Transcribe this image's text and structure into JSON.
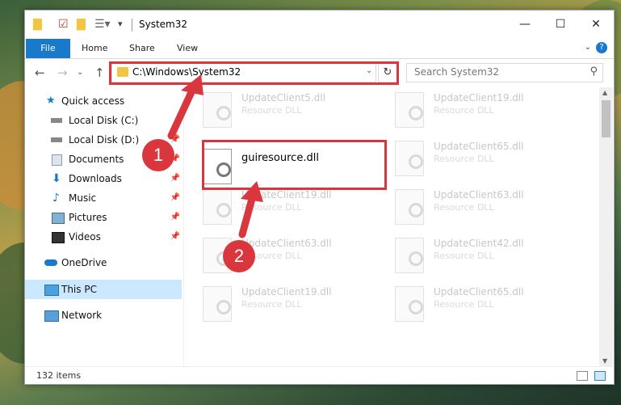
{
  "window": {
    "title": "System32",
    "controls": {
      "minimize": "—",
      "maximize": "☐",
      "close": "✕"
    }
  },
  "ribbon": {
    "file": "File",
    "tabs": [
      "Home",
      "Share",
      "View"
    ],
    "help": "?"
  },
  "nav": {
    "address": "C:\\Windows\\System32",
    "search_placeholder": "Search System32"
  },
  "sidebar": {
    "items": [
      {
        "label": "Quick access",
        "pinned": false
      },
      {
        "label": "Local Disk (C:)",
        "pinned": false
      },
      {
        "label": "Local Disk (D:)",
        "pinned": true
      },
      {
        "label": "Documents",
        "pinned": true
      },
      {
        "label": "Downloads",
        "pinned": true
      },
      {
        "label": "Music",
        "pinned": true
      },
      {
        "label": "Pictures",
        "pinned": true
      },
      {
        "label": "Videos",
        "pinned": true
      },
      {
        "label": "OneDrive",
        "pinned": false
      },
      {
        "label": "This PC",
        "pinned": false,
        "selected": true
      },
      {
        "label": "Network",
        "pinned": false
      }
    ]
  },
  "files": [
    {
      "name": "UpdateClient5.dll",
      "type": "Resource DLL"
    },
    {
      "name": "UpdateClient19.dll",
      "type": "Resource DLL"
    },
    {
      "name": "guiresource.dll",
      "type": ""
    },
    {
      "name": "UpdateClient65.dll",
      "type": "Resource DLL"
    },
    {
      "name": "UpdateClient19.dll",
      "type": "Resource DLL"
    },
    {
      "name": "UpdateClient63.dll",
      "type": "Resource DLL"
    },
    {
      "name": "UpdateClient63.dll",
      "type": "Resource DLL"
    },
    {
      "name": "UpdateClient42.dll",
      "type": "Resource DLL"
    },
    {
      "name": "UpdateClient19.dll",
      "type": "Resource DLL"
    },
    {
      "name": "UpdateClient65.dll",
      "type": "Resource DLL"
    }
  ],
  "status": {
    "item_count": "132 items"
  },
  "markers": {
    "step1": "1",
    "step2": "2"
  },
  "colors": {
    "accent": "#1979ca",
    "highlight": "#d9363e",
    "selection": "#cce8ff"
  }
}
